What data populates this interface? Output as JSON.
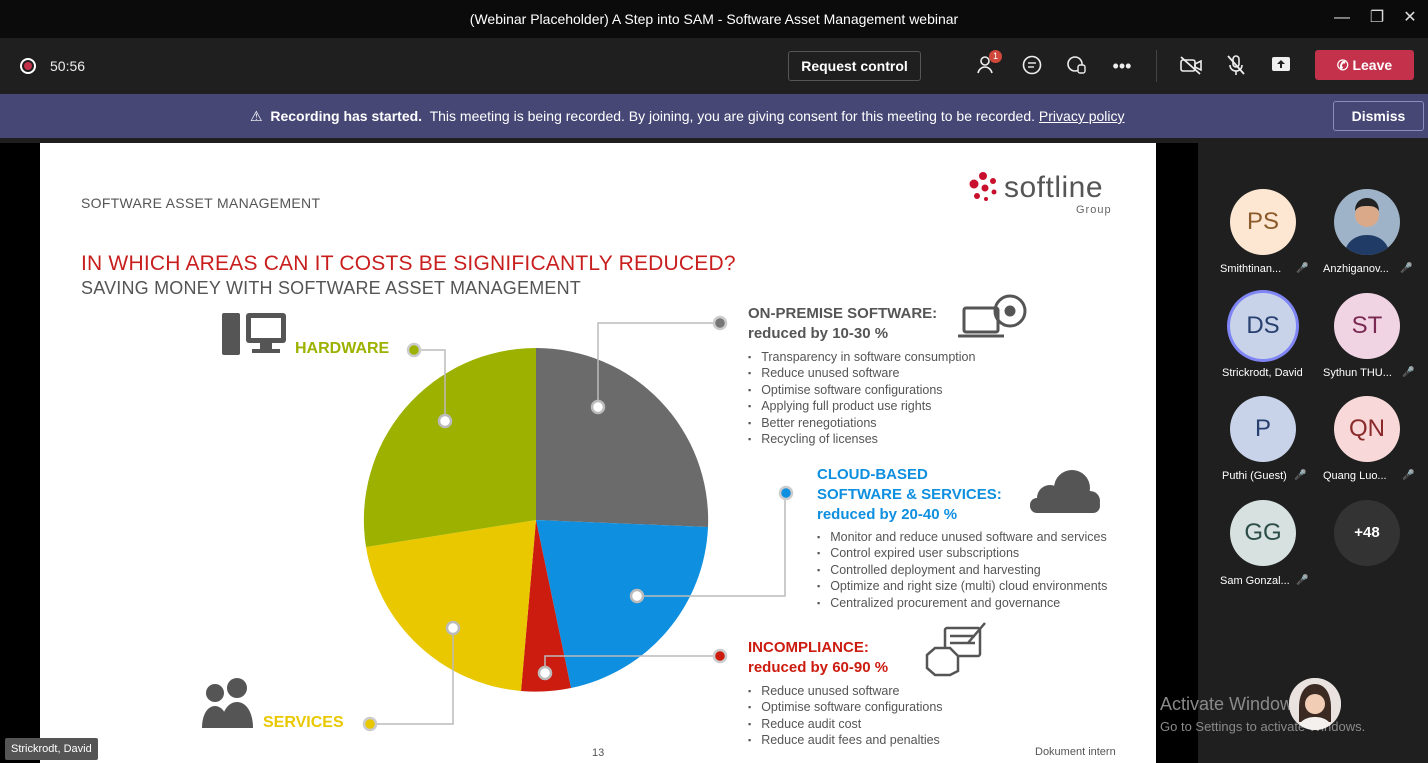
{
  "window": {
    "title": "(Webinar Placeholder) A Step into SAM - Software Asset Management webinar"
  },
  "toolbar": {
    "timer": "50:56",
    "request_control": "Request control",
    "participants_badge": "1",
    "leave": "Leave"
  },
  "banner": {
    "bold": "Recording has started.",
    "message": "This meeting is being recorded. By joining, you are giving consent for this meeting to be recorded.",
    "link": "Privacy policy",
    "dismiss": "Dismiss"
  },
  "slide": {
    "section": "SOFTWARE ASSET MANAGEMENT",
    "title": "IN WHICH AREAS CAN IT COSTS BE SIGNIFICANTLY REDUCED?",
    "subtitle": "SAVING MONEY WITH SOFTWARE ASSET MANAGEMENT",
    "brand": "softline",
    "brand_group": "Group",
    "hardware": "HARDWARE",
    "services": "SERVICES",
    "onprem": {
      "title": "ON-PREMISE SOFTWARE:",
      "sub": "reduced by 10-30 %",
      "bullets": [
        "Transparency in software consumption",
        "Reduce unused software",
        "Optimise software configurations",
        "Applying full product use rights",
        "Better renegotiations",
        "Recycling of licenses"
      ]
    },
    "cloud": {
      "title1": "CLOUD-BASED",
      "title2": "SOFTWARE & SERVICES:",
      "sub": "reduced by 20-40 %",
      "bullets": [
        "Monitor and reduce unused software and services",
        "Control expired user subscriptions",
        "Controlled deployment and harvesting",
        "Optimize and right size (multi) cloud environments",
        "Centralized procurement and governance"
      ]
    },
    "incompliance": {
      "title": "INCOMPLIANCE:",
      "sub": "reduced by 60-90 %",
      "bullets": [
        "Reduce unused software",
        "Optimise software configurations",
        "Reduce audit cost",
        "Reduce audit fees and penalties"
      ]
    },
    "page_number": "13",
    "footer": "Dokument intern"
  },
  "participants": [
    {
      "initials": "PS",
      "name": "Smithtinan...",
      "bg": "#fde7d3",
      "fg": "#8a5a2b"
    },
    {
      "initials": "",
      "name": "Anzhiganov...",
      "bg": "#6d7a8a",
      "fg": "#fff"
    },
    {
      "initials": "DS",
      "name": "Strickrodt, David",
      "bg": "#c8d3ea",
      "fg": "#27406f"
    },
    {
      "initials": "ST",
      "name": "Sythun THU...",
      "bg": "#f1d4e4",
      "fg": "#7a2a52"
    },
    {
      "initials": "P",
      "name": "Puthi (Guest)",
      "bg": "#c8d3ea",
      "fg": "#27406f"
    },
    {
      "initials": "QN",
      "name": "Quang Luo...",
      "bg": "#f8d8d8",
      "fg": "#8a2a2a"
    },
    {
      "initials": "GG",
      "name": "Sam Gonzal...",
      "bg": "#d7e2e0",
      "fg": "#2c4d48"
    },
    {
      "initials": "+48",
      "name": "",
      "bg": "#333333",
      "fg": "#fff"
    }
  ],
  "presenter_chip": "Strickrodt, David",
  "watermark": {
    "line1": "Activate Windows",
    "line2": "Go to Settings to activate Windows."
  },
  "colors": {
    "leave": "#c4314b",
    "banner": "#464775",
    "slice_gray": "#6b6b6b",
    "slice_blue": "#0e8fe0",
    "slice_red": "#cc1b0f",
    "slice_yellow": "#eac800",
    "slice_green": "#9db100"
  }
}
